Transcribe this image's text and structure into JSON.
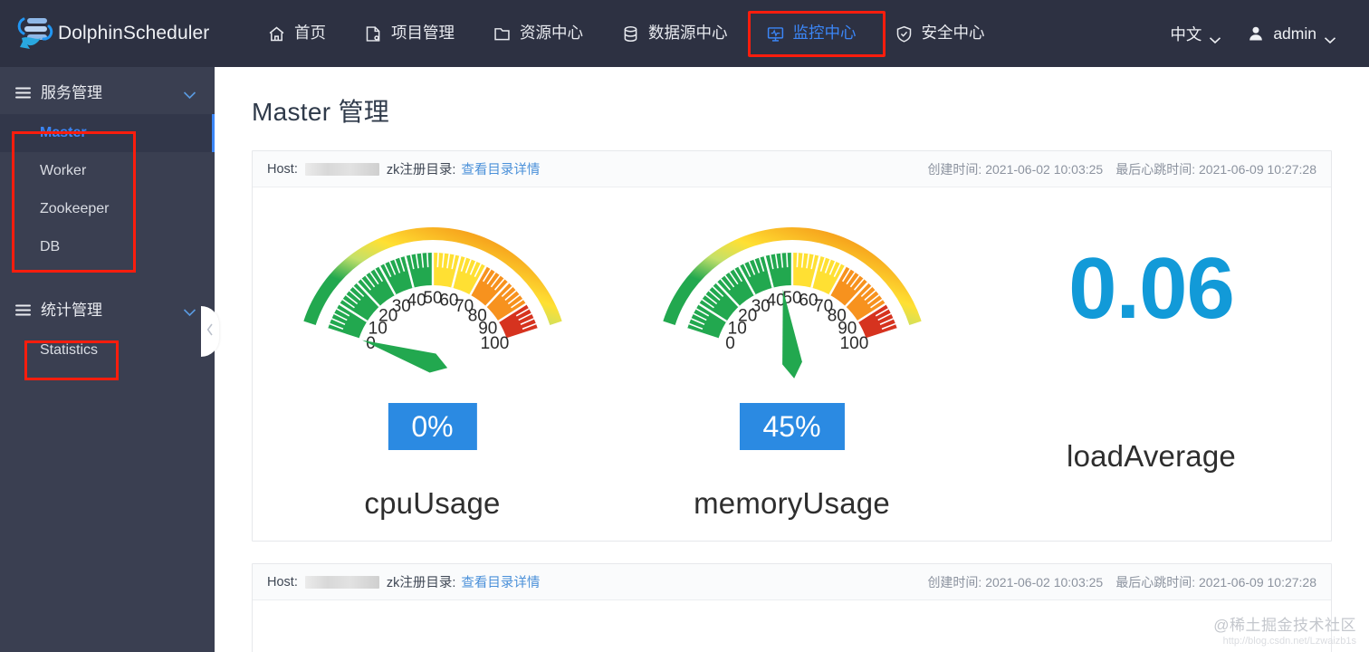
{
  "brand": {
    "name": "DolphinScheduler",
    "logo_icon": "dolphin-logo-icon"
  },
  "topnav": {
    "items": [
      {
        "label": "首页",
        "icon": "home-icon",
        "active": false
      },
      {
        "label": "项目管理",
        "icon": "project-icon",
        "active": false
      },
      {
        "label": "资源中心",
        "icon": "folder-icon",
        "active": false
      },
      {
        "label": "数据源中心",
        "icon": "database-icon",
        "active": false
      },
      {
        "label": "监控中心",
        "icon": "monitor-icon",
        "active": true
      },
      {
        "label": "安全中心",
        "icon": "shield-icon",
        "active": false
      }
    ],
    "language": {
      "label": "中文",
      "chevron_icon": "chevron-down-icon"
    },
    "user": {
      "label": "admin",
      "avatar_icon": "user-icon",
      "chevron_icon": "chevron-down-icon"
    }
  },
  "sidebar": {
    "groups": [
      {
        "label": "服务管理",
        "menu_icon": "hamburger-icon",
        "chevron_icon": "chevron-down-icon",
        "items": [
          {
            "label": "Master",
            "active": true
          },
          {
            "label": "Worker",
            "active": false
          },
          {
            "label": "Zookeeper",
            "active": false
          },
          {
            "label": "DB",
            "active": false
          }
        ]
      },
      {
        "label": "统计管理",
        "menu_icon": "hamburger-icon",
        "chevron_icon": "chevron-down-icon",
        "items": [
          {
            "label": "Statistics",
            "active": false
          }
        ]
      }
    ],
    "collapse_handle_icon": "chevron-left-icon"
  },
  "main": {
    "page_title": "Master 管理",
    "cards": [
      {
        "host_label": "Host:",
        "host_value_masked": true,
        "zk_label": "zk注册目录:",
        "zk_link": "查看目录详情",
        "create_time_label": "创建时间:",
        "create_time": "2021-06-02 10:03:25",
        "heartbeat_label": "最后心跳时间:",
        "heartbeat_time": "2021-06-09 10:27:28"
      },
      {
        "host_label": "Host:",
        "host_value_masked": true,
        "zk_label": "zk注册目录:",
        "zk_link": "查看目录详情",
        "create_time_label": "创建时间:",
        "create_time": "2021-06-02 10:03:25",
        "heartbeat_label": "最后心跳时间:",
        "heartbeat_time": "2021-06-09 10:27:28"
      }
    ]
  },
  "chart_data": [
    {
      "type": "gauge",
      "title": "cpuUsage",
      "value": 0,
      "display_value": "0%",
      "min": 0,
      "max": 100,
      "tick_labels": [
        0,
        10,
        20,
        30,
        40,
        50,
        60,
        70,
        80,
        90,
        100
      ],
      "bands": [
        {
          "from": 0,
          "to": 50,
          "color": "#22a84f"
        },
        {
          "from": 50,
          "to": 70,
          "color": "#ffe033"
        },
        {
          "from": 70,
          "to": 90,
          "color": "#f7921e"
        },
        {
          "from": 90,
          "to": 100,
          "color": "#d6331f"
        }
      ],
      "needle_color": "#22a84f",
      "badge_color": "#2b8ae2"
    },
    {
      "type": "gauge",
      "title": "memoryUsage",
      "value": 45,
      "display_value": "45%",
      "min": 0,
      "max": 100,
      "tick_labels": [
        0,
        10,
        20,
        30,
        40,
        50,
        60,
        70,
        80,
        90,
        100
      ],
      "bands": [
        {
          "from": 0,
          "to": 50,
          "color": "#22a84f"
        },
        {
          "from": 50,
          "to": 70,
          "color": "#ffe033"
        },
        {
          "from": 70,
          "to": 90,
          "color": "#f7921e"
        },
        {
          "from": 90,
          "to": 100,
          "color": "#d6331f"
        }
      ],
      "needle_color": "#22a84f",
      "badge_color": "#2b8ae2"
    },
    {
      "type": "number",
      "title": "loadAverage",
      "value": 0.06,
      "display_value": "0.06",
      "color": "#129ad8"
    }
  ],
  "watermark": {
    "line1": "@稀土掘金技术社区",
    "line2": "http://blog.csdn.net/Lzwaizb1s"
  }
}
